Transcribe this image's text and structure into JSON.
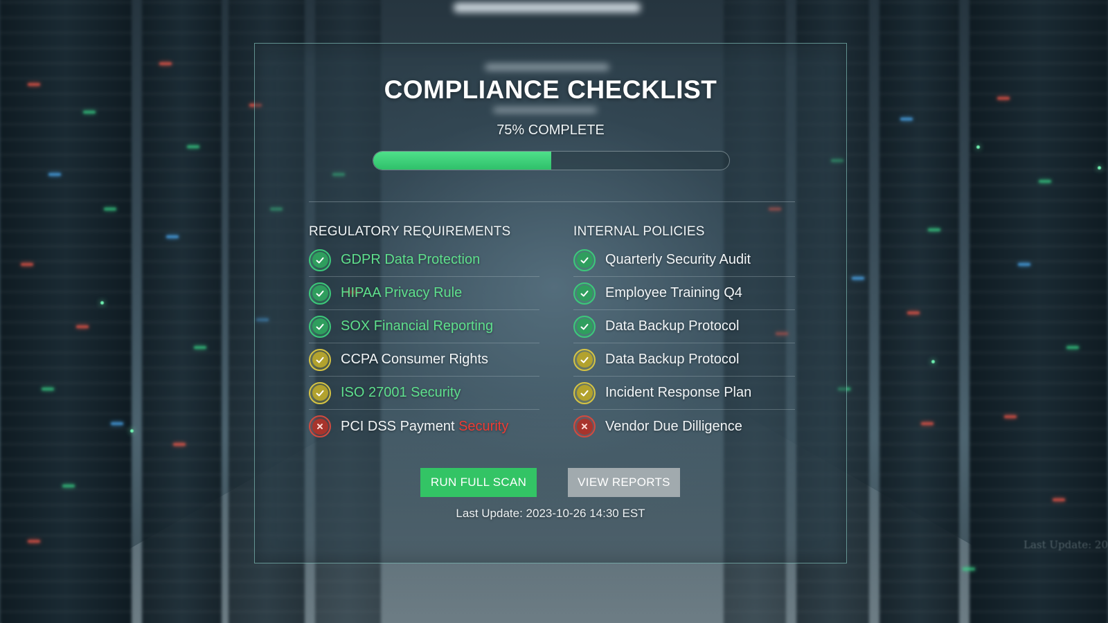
{
  "colors": {
    "accent_green": "#33c465",
    "progress_green": "#3fd07a",
    "status_ok": "#3cc97a",
    "status_warn": "#d6c443",
    "status_fail": "#d24a3f",
    "secondary_button": "#a1aaae",
    "panel_border": "#96dcd2"
  },
  "title": "COMPLIANCE CHECKLIST",
  "progress": {
    "label": "75% COMPLETE",
    "percent": 50
  },
  "regulatory": {
    "heading": "REGULATORY REQUIREMENTS",
    "items": [
      {
        "text": "GDPR Data Protection",
        "status": "ok",
        "icon": "check-icon"
      },
      {
        "text": "HIPAA Privacy Rule",
        "status": "ok",
        "icon": "check-icon"
      },
      {
        "text": "SOX Financial Reporting",
        "status": "ok",
        "icon": "check-icon"
      },
      {
        "text": "CCPA Consumer Rights",
        "status": "warn",
        "icon": "check-icon"
      },
      {
        "text": "ISO 27001 Security",
        "status": "warn",
        "icon": "check-icon"
      },
      {
        "text_main": "PCI DSS Payment",
        "text_alert": "Security",
        "status": "fail",
        "icon": "alert-icon"
      }
    ]
  },
  "internal": {
    "heading": "INTERNAL POLICIES",
    "items": [
      {
        "text": "Quarterly Security Audit",
        "status": "ok",
        "icon": "check-icon"
      },
      {
        "text": "Employee Training Q4",
        "status": "ok",
        "icon": "check-icon"
      },
      {
        "text": "Data Backup Protocol",
        "status": "ok",
        "icon": "check-icon"
      },
      {
        "text": "Data Backup Protocol",
        "status": "warn",
        "icon": "check-icon"
      },
      {
        "text": "Incident Response Plan",
        "status": "warn",
        "icon": "check-icon"
      },
      {
        "text": "Vendor Due Dilligence",
        "status": "fail",
        "icon": "alert-icon"
      }
    ]
  },
  "buttons": {
    "run_scan": "RUN FULL SCAN",
    "view_reports": "VIEW REPORTS"
  },
  "last_update": "Last Update: 2023-10-26 14:30 EST",
  "background_text": "Last Update: 20"
}
